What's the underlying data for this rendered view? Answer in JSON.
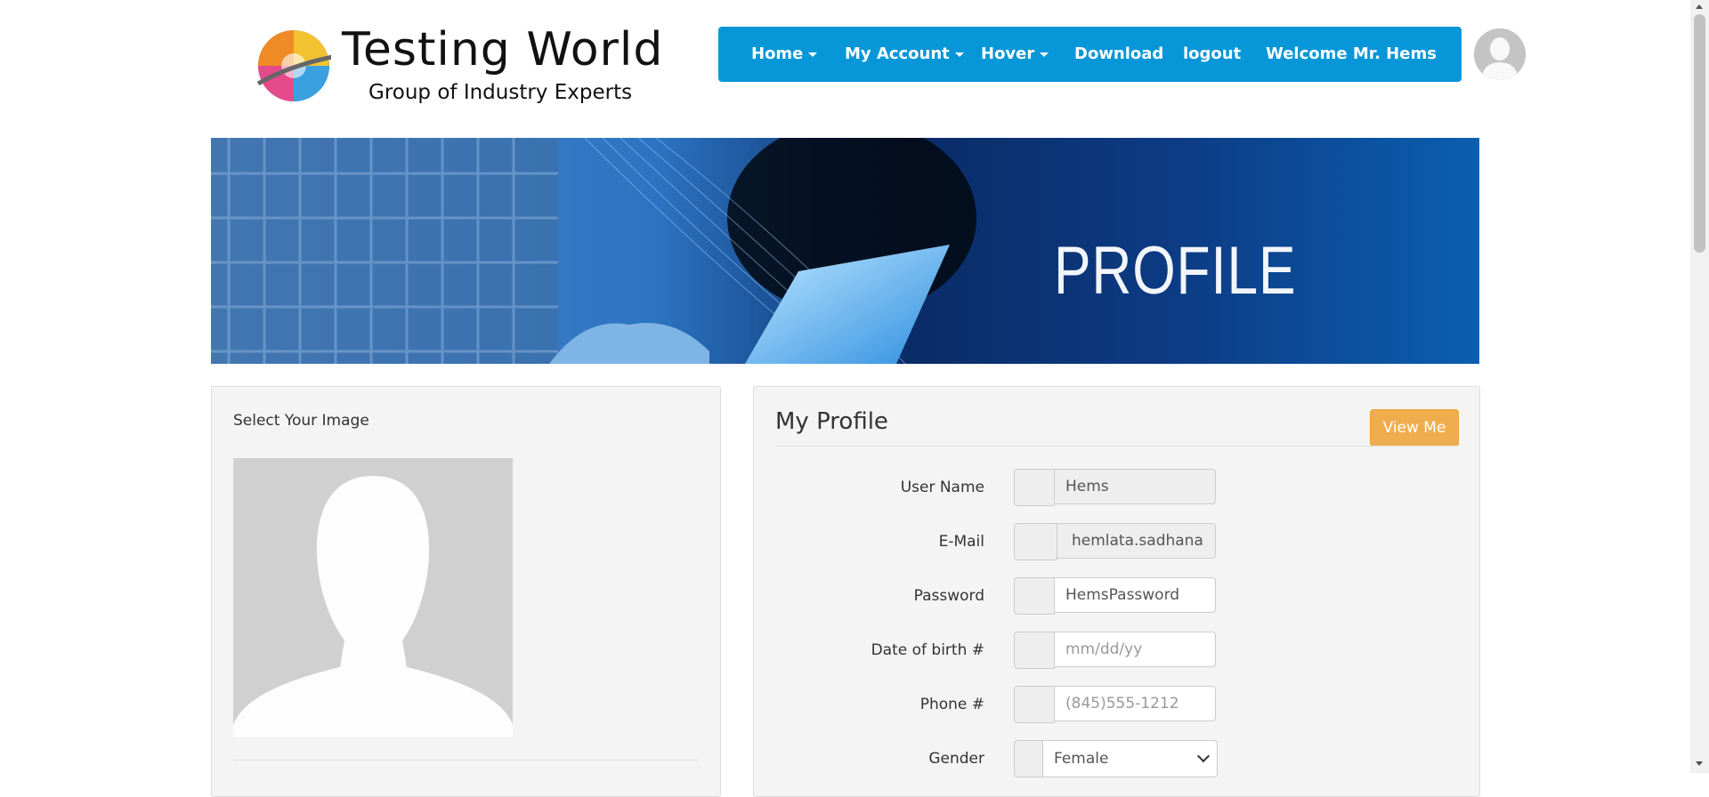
{
  "logo": {
    "title": "Testing World",
    "subtitle": "Group of Industry Experts"
  },
  "nav": {
    "items": [
      {
        "label": "Home",
        "dropdown": true
      },
      {
        "label": "My Account",
        "dropdown": true
      },
      {
        "label": "Hover",
        "dropdown": true
      },
      {
        "label": "Download",
        "dropdown": false
      },
      {
        "label": "logout",
        "dropdown": false
      },
      {
        "label": "Welcome Mr. Hems",
        "dropdown": false
      }
    ],
    "color": "#0797d8"
  },
  "banner": {
    "title": "PROFILE"
  },
  "image_panel": {
    "title": "Select Your Image"
  },
  "profile": {
    "heading": "My Profile",
    "view_button": "View Me",
    "fields": {
      "username": {
        "label": "User Name",
        "value": "Hems"
      },
      "email": {
        "label": "E-Mail",
        "value": "hemlata.sadhana"
      },
      "password": {
        "label": "Password",
        "value": "HemsPassword"
      },
      "dob": {
        "label": "Date of birth #",
        "placeholder": "mm/dd/yy"
      },
      "phone": {
        "label": "Phone #",
        "placeholder": "(845)555-1212"
      },
      "gender": {
        "label": "Gender",
        "value": "Female"
      }
    },
    "button_color": "#f0ad4e"
  }
}
